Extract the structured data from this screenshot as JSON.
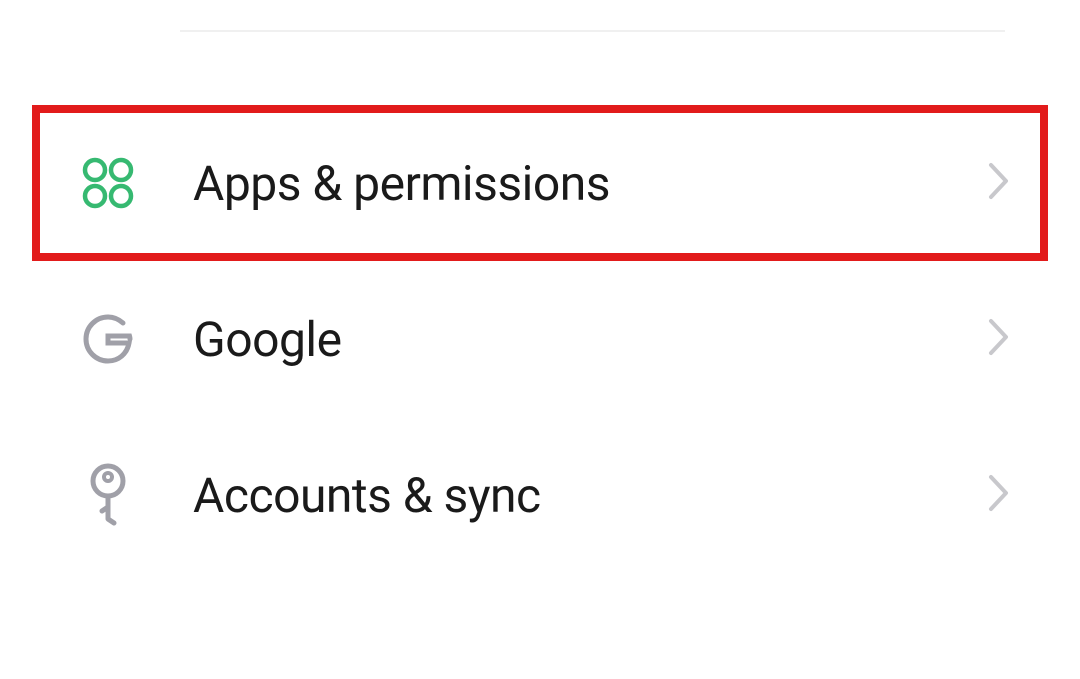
{
  "settings": {
    "items": [
      {
        "label": "Apps & permissions",
        "icon": "apps-icon",
        "highlighted": true
      },
      {
        "label": "Google",
        "icon": "google-icon",
        "highlighted": false
      },
      {
        "label": "Accounts & sync",
        "icon": "key-icon",
        "highlighted": false
      }
    ]
  },
  "colors": {
    "apps_icon": "#36b971",
    "neutral_icon": "#a0a0a8",
    "chevron": "#c8c8cc",
    "highlight_border": "#e21b1b",
    "text": "#1a1a1a"
  }
}
